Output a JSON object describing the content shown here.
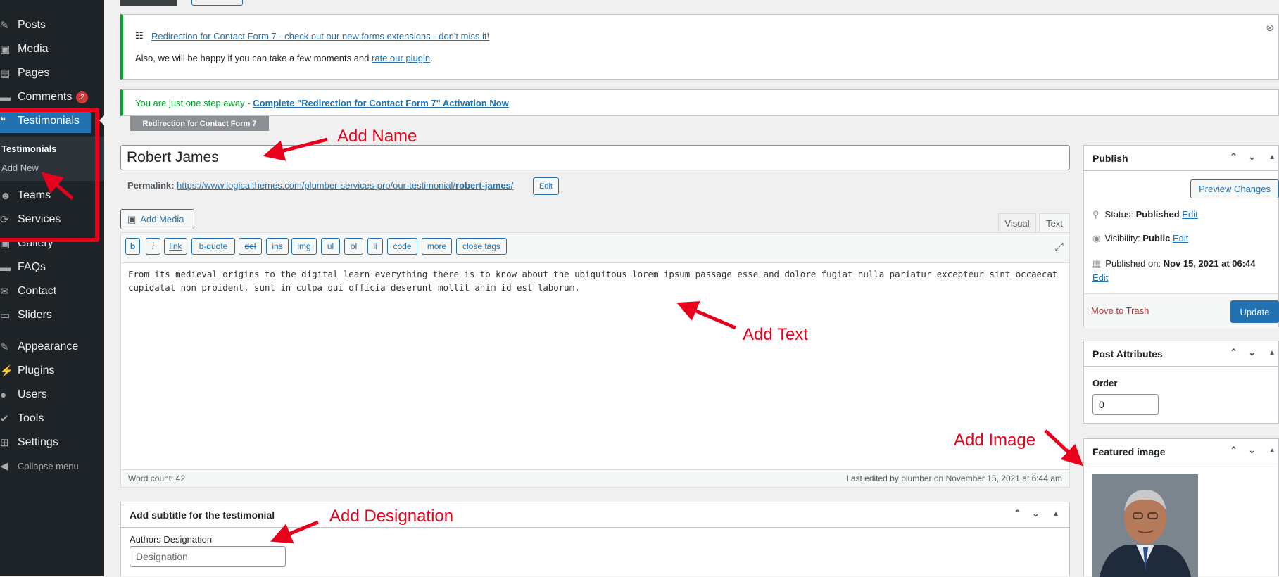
{
  "sidebar": {
    "items": [
      {
        "label": "Posts",
        "icon": "pushpin-icon"
      },
      {
        "label": "Media",
        "icon": "media-icon"
      },
      {
        "label": "Pages",
        "icon": "pages-icon"
      },
      {
        "label": "Comments",
        "icon": "comments-icon",
        "badge": "2"
      },
      {
        "label": "Testimonials",
        "icon": "testimonials-icon"
      },
      {
        "label": "Teams",
        "icon": "teams-icon"
      },
      {
        "label": "Services",
        "icon": "services-icon"
      },
      {
        "label": "Gallery",
        "icon": "gallery-icon"
      },
      {
        "label": "FAQs",
        "icon": "faqs-icon"
      },
      {
        "label": "Contact",
        "icon": "contact-icon"
      },
      {
        "label": "Sliders",
        "icon": "sliders-icon"
      },
      {
        "label": "Appearance",
        "icon": "appearance-icon"
      },
      {
        "label": "Plugins",
        "icon": "plugins-icon"
      },
      {
        "label": "Users",
        "icon": "users-icon"
      },
      {
        "label": "Tools",
        "icon": "tools-icon"
      },
      {
        "label": "Settings",
        "icon": "settings-icon"
      }
    ],
    "submenu": {
      "items": [
        "Testimonials",
        "Add New"
      ]
    },
    "collapse_label": "Collapse menu"
  },
  "notices": {
    "forms_link": "Redirection for Contact Form 7 - check out our new forms extensions - don't miss it!",
    "rate_prefix": "Also, we will be happy if you can take a few moments and ",
    "rate_link": "rate our plugin",
    "rate_suffix": ".",
    "activation_prefix": "You are just one step away - ",
    "activation_link": "Complete \"Redirection for Contact Form 7\" Activation Now",
    "plugin_tag": "Redirection for Contact Form 7"
  },
  "editor": {
    "title_value": "Robert James",
    "permalink_label": "Permalink:",
    "permalink_base": "https://www.logicalthemes.com/plumber-services-pro/our-testimonial/",
    "permalink_slug": "robert-james",
    "permalink_trailing": "/",
    "permalink_edit": "Edit",
    "add_media": "Add Media",
    "tab_visual": "Visual",
    "tab_text": "Text",
    "quicktags": [
      "b",
      "i",
      "link",
      "b-quote",
      "del",
      "ins",
      "img",
      "ul",
      "ol",
      "li",
      "code",
      "more",
      "close tags"
    ],
    "content": "From its medieval origins to the digital learn everything there is to know about the ubiquitous lorem ipsum passage esse and dolore fugiat nulla pariatur excepteur sint occaecat cupidatat non proident, sunt in culpa qui officia deserunt mollit anim id est laborum.",
    "word_count": "Word count: 42",
    "last_edited": "Last edited by plumber on November 15, 2021 at 6:44 am"
  },
  "subtitle_box": {
    "title": "Add subtitle for the testimonial",
    "field_label": "Authors Designation",
    "field_placeholder": "Designation"
  },
  "publish": {
    "title": "Publish",
    "preview_button": "Preview Changes",
    "status_label": "Status: ",
    "status_value": "Published",
    "visibility_label": "Visibility: ",
    "visibility_value": "Public",
    "published_label": "Published on: ",
    "published_value": "Nov 15, 2021 at 06:44",
    "edit_label": "Edit",
    "trash_link": "Move to Trash",
    "update_button": "Update"
  },
  "attributes": {
    "title": "Post Attributes",
    "order_label": "Order",
    "order_value": "0"
  },
  "featured": {
    "title": "Featured image"
  },
  "annotations": {
    "name": "Add Name",
    "text": "Add Text",
    "image": "Add Image",
    "designation": "Add Designation"
  },
  "colors": {
    "annotation": "#e8001c",
    "admin_blue": "#2271b1",
    "sidebar_bg": "#1d2327",
    "notice_green": "#00a32a"
  }
}
